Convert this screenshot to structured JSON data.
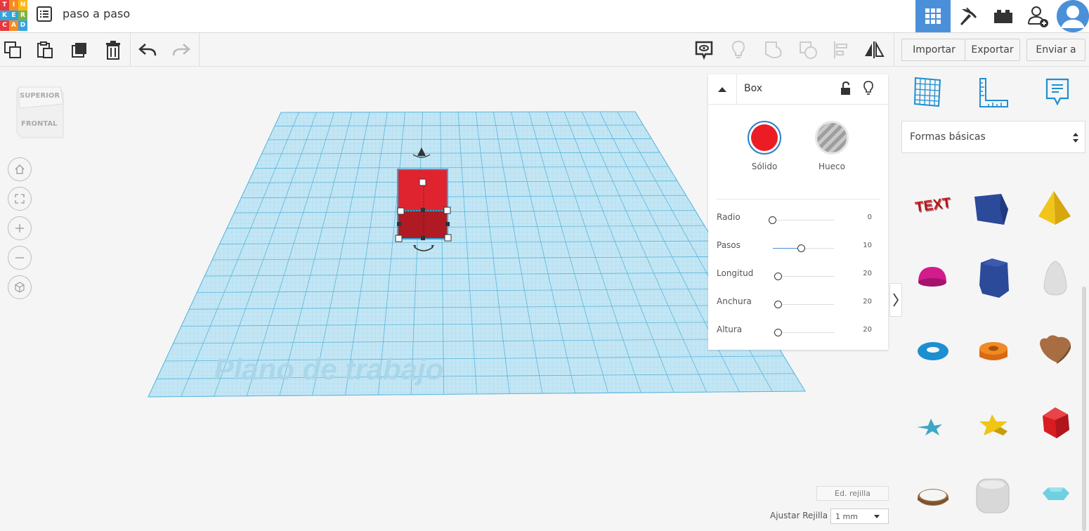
{
  "app": {
    "logo_letters": [
      "T",
      "I",
      "N",
      "K",
      "E",
      "R",
      "C",
      "A",
      "D"
    ],
    "logo_colors": [
      "#e8383d",
      "#f68b1f",
      "#fcb813",
      "#37a4dc",
      "#2aa6df",
      "#7cb342",
      "#e8383d",
      "#f68b1f",
      "#37a4dc"
    ],
    "project_title": "paso a paso",
    "accent_color": "#4a90d9"
  },
  "header": {
    "buttons": [
      "grid-view-icon",
      "pickaxe-icon",
      "bricks-icon",
      "add-user-icon",
      "user-avatar"
    ]
  },
  "toolbar": {
    "left_tools": [
      "copy-icon",
      "paste-icon",
      "duplicate-icon",
      "delete-icon",
      "undo-icon",
      "redo-icon"
    ],
    "right_tools": [
      "note-visibility-icon",
      "lightbulb-icon",
      "group-icon",
      "ungroup-icon",
      "align-icon",
      "mirror-icon"
    ],
    "import_label": "Importar",
    "export_label": "Exportar",
    "send_label": "Enviar a"
  },
  "viewcube": {
    "top_label": "SUPERIOR",
    "front_label": "FRONTAL"
  },
  "workplane": {
    "label": "Plano de trabajo",
    "grid_color": "#5ab6dc"
  },
  "shape_object": {
    "color": "#e0242f"
  },
  "inspector": {
    "shape_name": "Box",
    "solid_label": "Sólido",
    "hole_label": "Hueco",
    "solid_color": "#ec1c24",
    "params": [
      {
        "label": "Radio",
        "value": "0"
      },
      {
        "label": "Pasos",
        "value": "10"
      },
      {
        "label": "Longitud",
        "value": "20"
      },
      {
        "label": "Anchura",
        "value": "20"
      },
      {
        "label": "Altura",
        "value": "20"
      }
    ]
  },
  "right_panel": {
    "tab_icons": [
      "workplane-icon",
      "ruler-icon",
      "notes-icon"
    ],
    "category": "Formas básicas",
    "shapes": [
      "text-shape",
      "box-shape",
      "pyramid-shape",
      "half-sphere-shape",
      "polygon-shape",
      "paraboloid-shape",
      "torus-shape",
      "tube-shape",
      "heart-shape",
      "star-shape",
      "star-yellow-shape",
      "icosahedron-shape",
      "ring-shape",
      "rounded-box-shape",
      "gem-shape"
    ]
  },
  "grid_controls": {
    "edit_grid_label": "Ed. rejilla",
    "snap_label": "Ajustar Rejilla",
    "snap_value": "1 mm"
  }
}
